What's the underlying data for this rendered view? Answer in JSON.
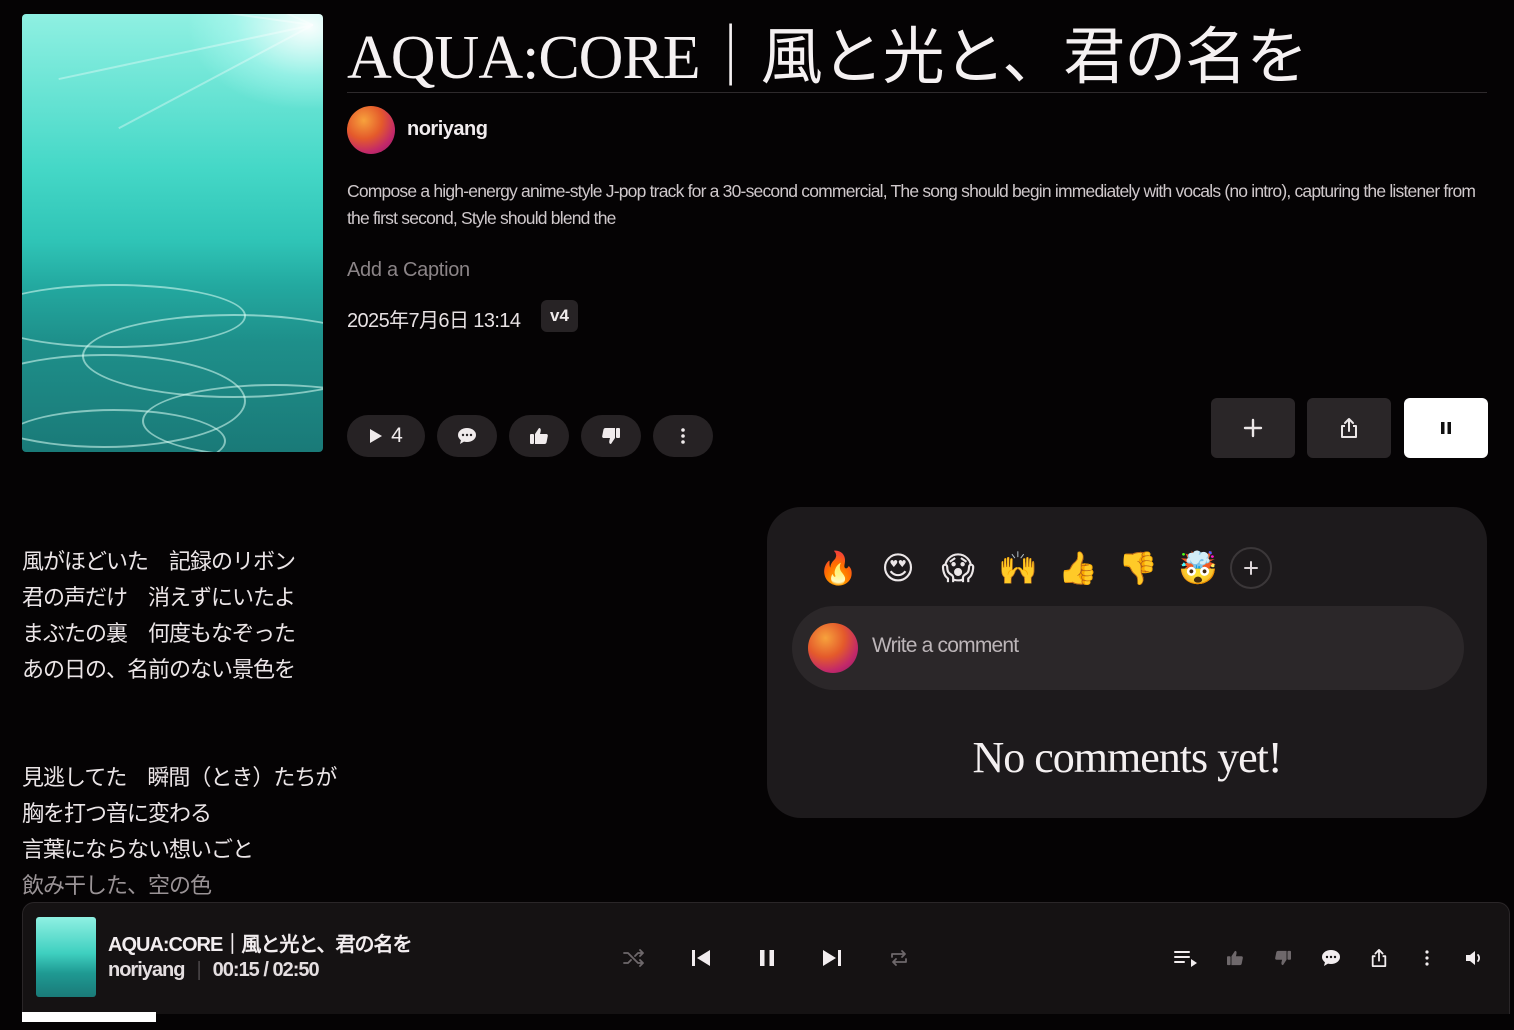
{
  "song": {
    "title": "AQUA:CORE｜風と光と、君の名を",
    "author": "noriyang",
    "description": "Compose a high-energy anime-style J-pop track for a 30-second commercial, The song should begin immediately with vocals (no intro), capturing the listener from the first second, Style should blend the",
    "caption_placeholder": "Add a Caption",
    "date": "2025年7月6日 13:14",
    "version": "v4",
    "play_count": "4"
  },
  "lyrics": {
    "verse1": [
      "風がほどいた　記録のリボン",
      "君の声だけ　消えずにいたよ",
      "まぶたの裏　何度もなぞった",
      "あの日の、名前のない景色を"
    ],
    "verse2": [
      "見逃してた　瞬間（とき）たちが",
      "胸を打つ音に変わる",
      "言葉にならない想いごと",
      "飲み干した、空の色"
    ]
  },
  "comments": {
    "reactions": [
      "🔥",
      "😍",
      "😱",
      "🙌",
      "👍",
      "👎",
      "🤯"
    ],
    "input_placeholder": "Write a comment",
    "empty_text": "No comments yet!"
  },
  "player": {
    "title": "AQUA:CORE｜風と光と、君の名を",
    "artist": "noriyang",
    "separator": "|",
    "time": "00:15 / 02:50",
    "progress_fraction": 0.09
  },
  "colors": {
    "background": "#050304",
    "card": "#1d1a1c",
    "pill": "#262224"
  }
}
